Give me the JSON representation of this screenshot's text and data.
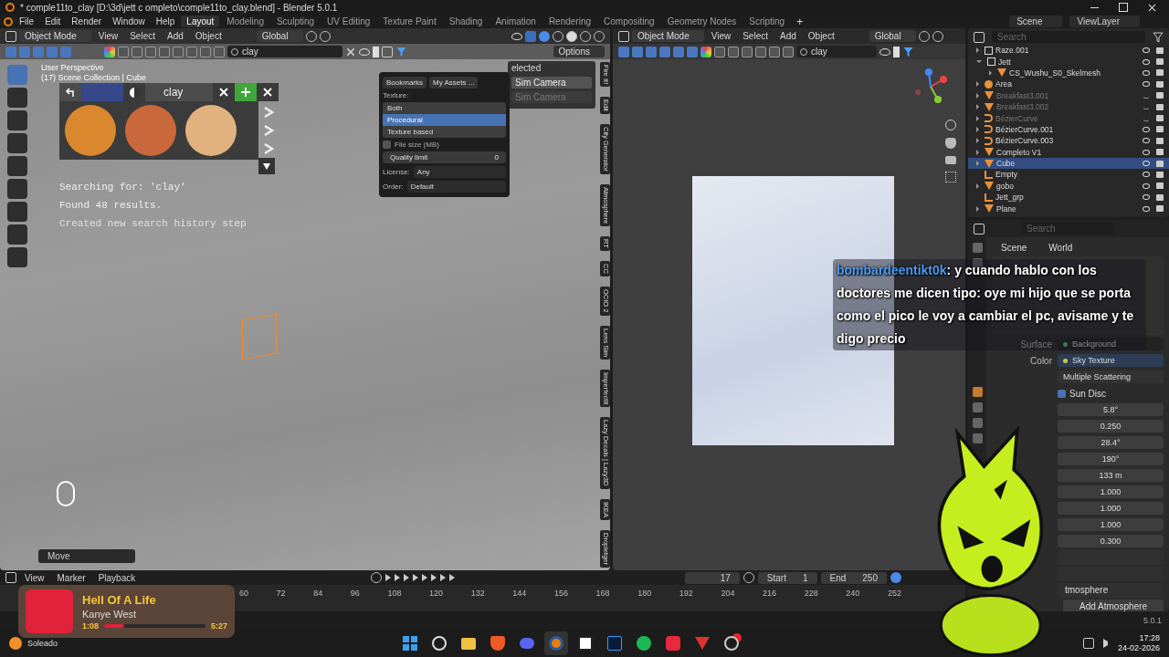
{
  "window": {
    "title": "* comple11to_clay [D:\\3d\\jett c ompleto\\comple11to_clay.blend] - Blender 5.0.1"
  },
  "menu": [
    "File",
    "Edit",
    "Render",
    "Window",
    "Help"
  ],
  "workspaces": [
    {
      "label": "Layout",
      "selected": true
    },
    {
      "label": "Modeling",
      "selected": false
    },
    {
      "label": "Sculpting",
      "selected": false
    },
    {
      "label": "UV Editing",
      "selected": false
    },
    {
      "label": "Texture Paint",
      "selected": false
    },
    {
      "label": "Shading",
      "selected": false
    },
    {
      "label": "Animation",
      "selected": false
    },
    {
      "label": "Rendering",
      "selected": false
    },
    {
      "label": "Compositing",
      "selected": false
    },
    {
      "label": "Geometry Nodes",
      "selected": false
    },
    {
      "label": "Scripting",
      "selected": false
    }
  ],
  "add_workspace": "+",
  "scene": "Scene",
  "view_layer": "ViewLayer",
  "viewport": {
    "mode": "Object Mode",
    "menus": [
      "View",
      "Select",
      "Add",
      "Object"
    ],
    "orientation": "Global",
    "search": "clay",
    "options": "Options",
    "overlay_lines": [
      "User Perspective",
      "(17) Scene Collection | Cube"
    ],
    "asset_bar": {
      "query": "clay",
      "swatches": [
        {
          "color": "#d9882e"
        },
        {
          "color": "#c9683a"
        },
        {
          "color": "#e2b27e"
        }
      ]
    },
    "console": [
      "Searching for: 'clay'",
      "Found 48 results.",
      "Created new search history step"
    ],
    "filter_popup": {
      "buttons": [
        "Bookmarks",
        "My Assets ..."
      ],
      "texture_label": "Texture:",
      "texture_options": [
        {
          "label": "Both",
          "selected": false
        },
        {
          "label": "Procedural",
          "selected": true
        },
        {
          "label": "Texture based",
          "selected": false
        }
      ],
      "file_size": {
        "label": "File size (MB)",
        "checked": false
      },
      "quality": {
        "label": "Quality limit",
        "value": "0"
      },
      "license": {
        "label": "License:",
        "value": "Any"
      },
      "order": {
        "label": "Order:",
        "value": "Default"
      }
    },
    "side_panel": {
      "title": "elected",
      "buttons": [
        {
          "label": "Sim Camera",
          "disabled": false
        },
        {
          "label": "Sim Camera",
          "disabled": true
        }
      ]
    },
    "side_tabs": [
      "Fire It!",
      "Edit",
      "City Generator",
      "Atmosphere",
      "RT",
      "CC",
      "OCIO 2",
      "Lens Sim",
      "ImperfectIt",
      "Lazy Decals | Lazy3D",
      "IKEA",
      "Dropletger"
    ],
    "last_operator": "Move"
  },
  "viewport_right": {
    "mode": "Object Mode",
    "menus": [
      "View",
      "Select",
      "Add",
      "Object"
    ],
    "orientation": "Global",
    "search": "clay"
  },
  "outliner": {
    "search_placeholder": "Search",
    "items": [
      {
        "name": "Raze.001",
        "kind": "collection",
        "hidden": false,
        "selected": false
      },
      {
        "name": "Jett",
        "kind": "collection",
        "hidden": false,
        "selected": false,
        "children": [
          {
            "name": "CS_Wushu_S0_Skelmesh",
            "kind": "mesh",
            "hidden": false,
            "selected": false
          }
        ]
      },
      {
        "name": "Area",
        "kind": "light",
        "hidden": false,
        "selected": false
      },
      {
        "name": "Breakfast3.001",
        "kind": "mesh",
        "hidden": true,
        "selected": false
      },
      {
        "name": "Breakfast3.002",
        "kind": "mesh",
        "hidden": true,
        "selected": false
      },
      {
        "name": "BézierCurve",
        "kind": "curve",
        "hidden": true,
        "selected": false
      },
      {
        "name": "BézierCurve.001",
        "kind": "curve",
        "hidden": false,
        "selected": false
      },
      {
        "name": "BézierCurve.003",
        "kind": "curve",
        "hidden": false,
        "selected": false
      },
      {
        "name": "Completo V1",
        "kind": "mesh",
        "hidden": false,
        "selected": false
      },
      {
        "name": "Cube",
        "kind": "mesh",
        "hidden": false,
        "selected": true
      },
      {
        "name": "Empty",
        "kind": "empty",
        "hidden": false,
        "selected": false
      },
      {
        "name": "gobo",
        "kind": "mesh",
        "hidden": false,
        "selected": false
      },
      {
        "name": "Jett_grp",
        "kind": "empty",
        "hidden": false,
        "selected": false
      },
      {
        "name": "Plane",
        "kind": "mesh",
        "hidden": false,
        "selected": false
      }
    ]
  },
  "properties": {
    "search_placeholder": "Search",
    "breadcrumb": [
      "Scene",
      "World"
    ],
    "surface": {
      "label": "Surface",
      "value": "Background"
    },
    "color": {
      "label": "Color",
      "value": "Sky Texture"
    },
    "sky_type": "Multiple Scattering",
    "sun_disc": {
      "label": "Sun Disc",
      "checked": true
    },
    "values": [
      "5.8°",
      "0.250",
      "28.4°",
      "190°",
      "133 m",
      "1.000",
      "1.000",
      "1.000",
      "0.300"
    ],
    "atmosphere_panel": "tmosphere",
    "add_button": "Add Atmosphere"
  },
  "timeline": {
    "menus": [
      "View",
      "Marker",
      "Playback"
    ],
    "current_frame": "17",
    "start": {
      "label": "Start",
      "value": "1"
    },
    "end": {
      "label": "End",
      "value": "250"
    },
    "ticks": [
      "60",
      "72",
      "84",
      "96",
      "108",
      "120",
      "132",
      "144",
      "156",
      "168",
      "180",
      "192",
      "204",
      "216",
      "228",
      "240",
      "252"
    ]
  },
  "version": "5.0.1",
  "chat": {
    "user": "bombardeentikt0k",
    "message": ": y cuando hablo con los doctores me dicen tipo: oye mi hijo que se porta como el pico le voy a cambiar el pc, avisame y te digo precio"
  },
  "now_playing": {
    "title": "Hell Of A Life",
    "artist": "Kanye West",
    "elapsed": "1:08",
    "duration": "5:27",
    "level": 0.2
  },
  "taskbar": {
    "weather": "Soleado",
    "apps": [
      {
        "kind": "start",
        "selected": false
      },
      {
        "kind": "search",
        "selected": false
      },
      {
        "kind": "folder",
        "selected": false
      },
      {
        "kind": "shield",
        "selected": false
      },
      {
        "kind": "gamepad",
        "selected": false
      },
      {
        "kind": "orbit",
        "selected": true
      },
      {
        "kind": "notebook",
        "selected": false
      },
      {
        "kind": "ps",
        "selected": false
      },
      {
        "kind": "music",
        "selected": false
      },
      {
        "kind": "smile",
        "selected": false
      },
      {
        "kind": "vee",
        "selected": false
      },
      {
        "kind": "badge",
        "selected": false
      }
    ],
    "time": "17:28",
    "date": "24-02-2026"
  }
}
